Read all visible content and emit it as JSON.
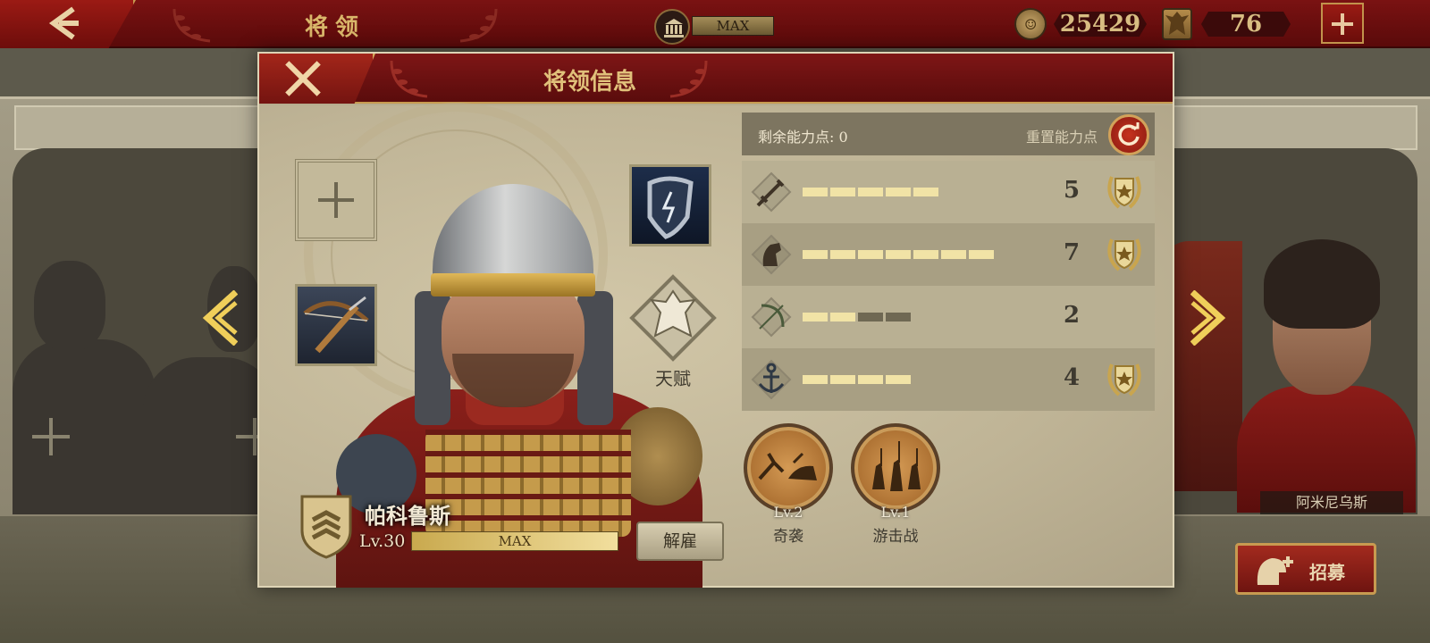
{
  "topbar": {
    "title": "将领",
    "building_level": "MAX",
    "coins": "25429",
    "spqr_tokens": "76"
  },
  "modal": {
    "title": "将领信息"
  },
  "equipment": {
    "talent_label": "天赋"
  },
  "hero": {
    "name": "帕科鲁斯",
    "level": "Lv.30",
    "exp_label": "MAX",
    "exp_progress": 1.0,
    "dismiss_label": "解雇"
  },
  "ability_points": {
    "remaining_label": "剩余能力点:",
    "remaining_value": "0",
    "reset_label": "重置能力点"
  },
  "stats": [
    {
      "name": "infantry",
      "icon": "sword-icon",
      "value": "5",
      "filled": 5,
      "total": 5,
      "badge": true
    },
    {
      "name": "cavalry",
      "icon": "horse-icon",
      "value": "7",
      "filled": 7,
      "total": 7,
      "badge": true
    },
    {
      "name": "archery",
      "icon": "bow-icon",
      "value": "2",
      "filled": 2,
      "total": 4,
      "badge": false
    },
    {
      "name": "navy",
      "icon": "anchor-icon",
      "value": "4",
      "filled": 4,
      "total": 4,
      "badge": true
    }
  ],
  "skills": [
    {
      "level": "Lv.2",
      "name": "奇袭",
      "icon": "ambush-icon"
    },
    {
      "level": "Lv.1",
      "name": "游击战",
      "icon": "guerrilla-icon"
    }
  ],
  "background": {
    "neighbor_hero_name": "阿米尼乌斯",
    "recruit_label": "招募"
  },
  "colors": {
    "primary_red": "#7a1212",
    "gold": "#c89a50",
    "parchment": "#b7ad8f",
    "bar_on": "#f1e3a6",
    "bar_off": "#6f6853"
  }
}
